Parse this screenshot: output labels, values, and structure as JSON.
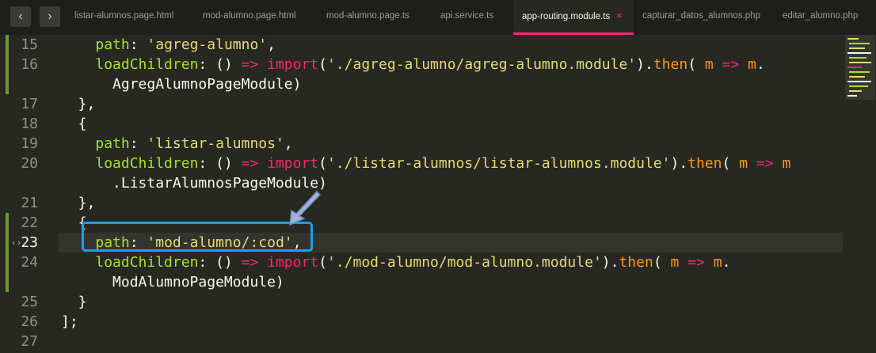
{
  "tabs": [
    {
      "label": "listar-alumnos.page.html",
      "active": false
    },
    {
      "label": "mod-alumno.page.html",
      "active": false
    },
    {
      "label": "mod-alumno.page.ts",
      "active": false
    },
    {
      "label": "api.service.ts",
      "active": false
    },
    {
      "label": "app-routing.module.ts",
      "active": true
    },
    {
      "label": "capturar_datos_alumnos.php",
      "active": false
    },
    {
      "label": "editar_alumno.php",
      "active": false
    }
  ],
  "nav": {
    "back_icon": "‹",
    "forward_icon": "›"
  },
  "tab_close_icon": "×",
  "gutter_marker_icon": "‹›",
  "line_numbers": [
    "15",
    "16",
    "",
    "17",
    "18",
    "19",
    "20",
    "",
    "21",
    "22",
    "23",
    "24",
    "",
    "25",
    "26",
    "27"
  ],
  "current_line": "23",
  "code_lines": [
    [
      {
        "t": "    ",
        "c": ""
      },
      {
        "t": "path",
        "c": "k"
      },
      {
        "t": ": ",
        "c": ""
      },
      {
        "t": "'agreg-alumno'",
        "c": "s"
      },
      {
        "t": ",",
        "c": ""
      }
    ],
    [
      {
        "t": "    ",
        "c": ""
      },
      {
        "t": "loadChildren",
        "c": "k"
      },
      {
        "t": ": () ",
        "c": ""
      },
      {
        "t": "=>",
        "c": "o"
      },
      {
        "t": " ",
        "c": ""
      },
      {
        "t": "import",
        "c": "o"
      },
      {
        "t": "(",
        "c": ""
      },
      {
        "t": "'./agreg-alumno/agreg-alumno.module'",
        "c": "s"
      },
      {
        "t": ").",
        "c": ""
      },
      {
        "t": "then",
        "c": "p"
      },
      {
        "t": "( ",
        "c": ""
      },
      {
        "t": "m",
        "c": "p"
      },
      {
        "t": " ",
        "c": ""
      },
      {
        "t": "=>",
        "c": "o"
      },
      {
        "t": " ",
        "c": ""
      },
      {
        "t": "m",
        "c": "p"
      },
      {
        "t": ".",
        "c": ""
      }
    ],
    [
      {
        "t": "      AgregAlumnoPageModule)",
        "c": ""
      }
    ],
    [
      {
        "t": "  },",
        "c": ""
      }
    ],
    [
      {
        "t": "  {",
        "c": ""
      }
    ],
    [
      {
        "t": "    ",
        "c": ""
      },
      {
        "t": "path",
        "c": "k"
      },
      {
        "t": ": ",
        "c": ""
      },
      {
        "t": "'listar-alumnos'",
        "c": "s"
      },
      {
        "t": ",",
        "c": ""
      }
    ],
    [
      {
        "t": "    ",
        "c": ""
      },
      {
        "t": "loadChildren",
        "c": "k"
      },
      {
        "t": ": () ",
        "c": ""
      },
      {
        "t": "=>",
        "c": "o"
      },
      {
        "t": " ",
        "c": ""
      },
      {
        "t": "import",
        "c": "o"
      },
      {
        "t": "(",
        "c": ""
      },
      {
        "t": "'./listar-alumnos/listar-alumnos.module'",
        "c": "s"
      },
      {
        "t": ").",
        "c": ""
      },
      {
        "t": "then",
        "c": "p"
      },
      {
        "t": "( ",
        "c": ""
      },
      {
        "t": "m",
        "c": "p"
      },
      {
        "t": " ",
        "c": ""
      },
      {
        "t": "=>",
        "c": "o"
      },
      {
        "t": " ",
        "c": ""
      },
      {
        "t": "m",
        "c": "p"
      }
    ],
    [
      {
        "t": "      .ListarAlumnosPageModule)",
        "c": ""
      }
    ],
    [
      {
        "t": "  },",
        "c": ""
      }
    ],
    [
      {
        "t": "  {",
        "c": ""
      }
    ],
    [
      {
        "t": "    ",
        "c": ""
      },
      {
        "t": "path",
        "c": "k"
      },
      {
        "t": ": ",
        "c": ""
      },
      {
        "t": "'mod-alumno/:cod'",
        "c": "s"
      },
      {
        "t": ",",
        "c": ""
      }
    ],
    [
      {
        "t": "    ",
        "c": ""
      },
      {
        "t": "loadChildren",
        "c": "k"
      },
      {
        "t": ": () ",
        "c": ""
      },
      {
        "t": "=>",
        "c": "o"
      },
      {
        "t": " ",
        "c": ""
      },
      {
        "t": "import",
        "c": "o"
      },
      {
        "t": "(",
        "c": ""
      },
      {
        "t": "'./mod-alumno/mod-alumno.module'",
        "c": "s"
      },
      {
        "t": ").",
        "c": ""
      },
      {
        "t": "then",
        "c": "p"
      },
      {
        "t": "( ",
        "c": ""
      },
      {
        "t": "m",
        "c": "p"
      },
      {
        "t": " ",
        "c": ""
      },
      {
        "t": "=>",
        "c": "o"
      },
      {
        "t": " ",
        "c": ""
      },
      {
        "t": "m",
        "c": "p"
      },
      {
        "t": ".",
        "c": ""
      }
    ],
    [
      {
        "t": "      ModAlumnoPageModule)",
        "c": ""
      }
    ],
    [
      {
        "t": "  }",
        "c": ""
      }
    ],
    [
      {
        "t": "];",
        "c": ""
      }
    ],
    [
      {
        "t": "",
        "c": ""
      }
    ]
  ],
  "colors": {
    "background": "#272822",
    "tabbar": "#1e1f1c",
    "accent": "#f92672",
    "keyword": "#a6e22e",
    "string": "#e6db74",
    "highlight_box": "#18a0e8",
    "gutter_changed": "#6a9a3a"
  }
}
